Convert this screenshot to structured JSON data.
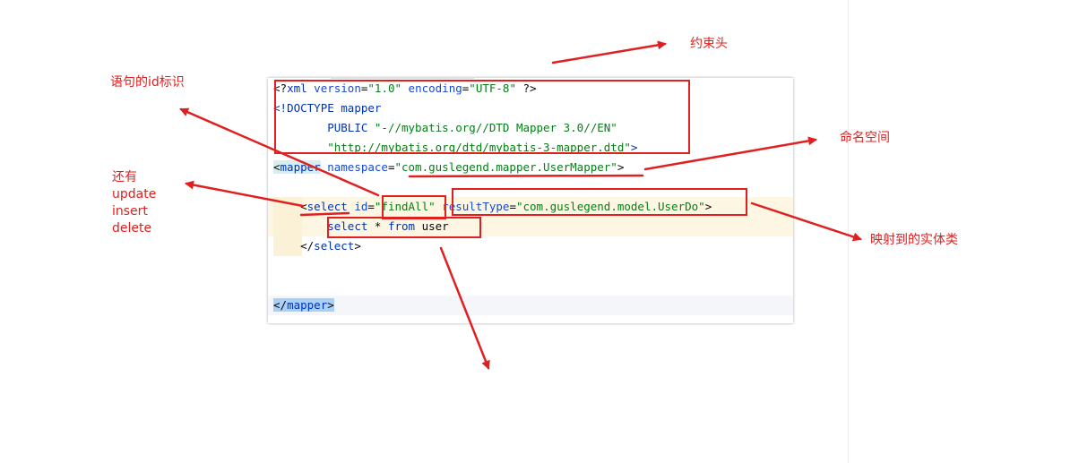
{
  "code": {
    "line1": {
      "open": "<?",
      "tag": "xml",
      "attr1": " version",
      "eq1": "=",
      "val1": "\"1.0\"",
      "attr2": " encoding",
      "eq2": "=",
      "val2": "\"UTF-8\"",
      "close": " ?>"
    },
    "line2": {
      "open": "<!",
      "tag": "DOCTYPE mapper"
    },
    "line3": {
      "indent": "        ",
      "kw": "PUBLIC",
      "val": " \"-//mybatis.org//DTD Mapper 3.0//EN\""
    },
    "line4": {
      "indent": "        ",
      "val": "\"http://mybatis.org/dtd/mybatis-3-mapper.dtd\"",
      "close": ">"
    },
    "line5": {
      "open": "<",
      "tag": "mapper",
      "attr": " namespace",
      "eq": "=",
      "val": "\"com.guslegend.mapper.UserMapper\"",
      "close": ">"
    },
    "line7": {
      "indent": "    ",
      "open": "<",
      "tag": "select",
      "attr1": " id",
      "eq1": "=",
      "val1": "\"findAll\"",
      "attr2": " resultType",
      "eq2": "=",
      "val2": "\"com.guslegend.model.UserDo\"",
      "close": ">"
    },
    "line8": {
      "indent": "        ",
      "kw1": "select",
      "mid": " * ",
      "kw2": "from",
      "rest": " user"
    },
    "line9": {
      "indent": "    ",
      "open": "</",
      "tag": "select",
      "close": ">"
    },
    "line12": {
      "open": "</",
      "tag": "mapper",
      "close": ">"
    }
  },
  "annotations": {
    "constraint_header": "约束头",
    "statement_id": "语句的id标识",
    "namespace": "命名空间",
    "also_label": "还有",
    "also_items": [
      "update",
      "insert",
      "delete"
    ],
    "mapped_entity": "映射到的实体类"
  },
  "colors": {
    "annotation_red": "#e02020",
    "xml_tag": "#0033b3",
    "xml_value": "#067d17",
    "highlight_yellow": "#fdf6e3"
  }
}
